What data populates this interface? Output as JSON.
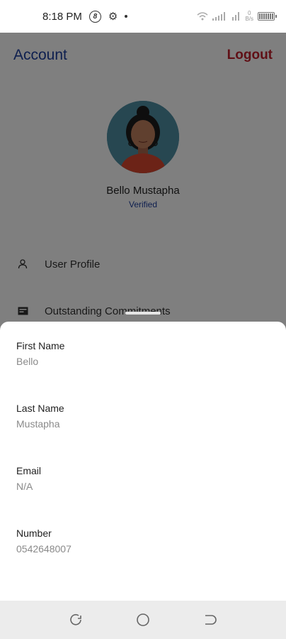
{
  "status_bar": {
    "time": "8:18 PM",
    "badge": "8",
    "data_top": "0",
    "data_unit": "B/s"
  },
  "header": {
    "title": "Account",
    "logout_label": "Logout"
  },
  "profile": {
    "name": "Bello Mustapha",
    "status": "Verified"
  },
  "menu": {
    "items": [
      {
        "label": "User Profile",
        "icon": "person-icon"
      },
      {
        "label": "Outstanding Commitments",
        "icon": "card-icon"
      }
    ]
  },
  "sheet": {
    "fields": [
      {
        "label": "First Name",
        "value": "Bello"
      },
      {
        "label": "Last Name",
        "value": "Mustapha"
      },
      {
        "label": "Email",
        "value": "N/A"
      },
      {
        "label": "Number",
        "value": "0542648007"
      }
    ]
  },
  "colors": {
    "brand_blue": "#1d3f9e",
    "logout_red": "#c0212d",
    "avatar_bg": "#4f8ea3"
  }
}
